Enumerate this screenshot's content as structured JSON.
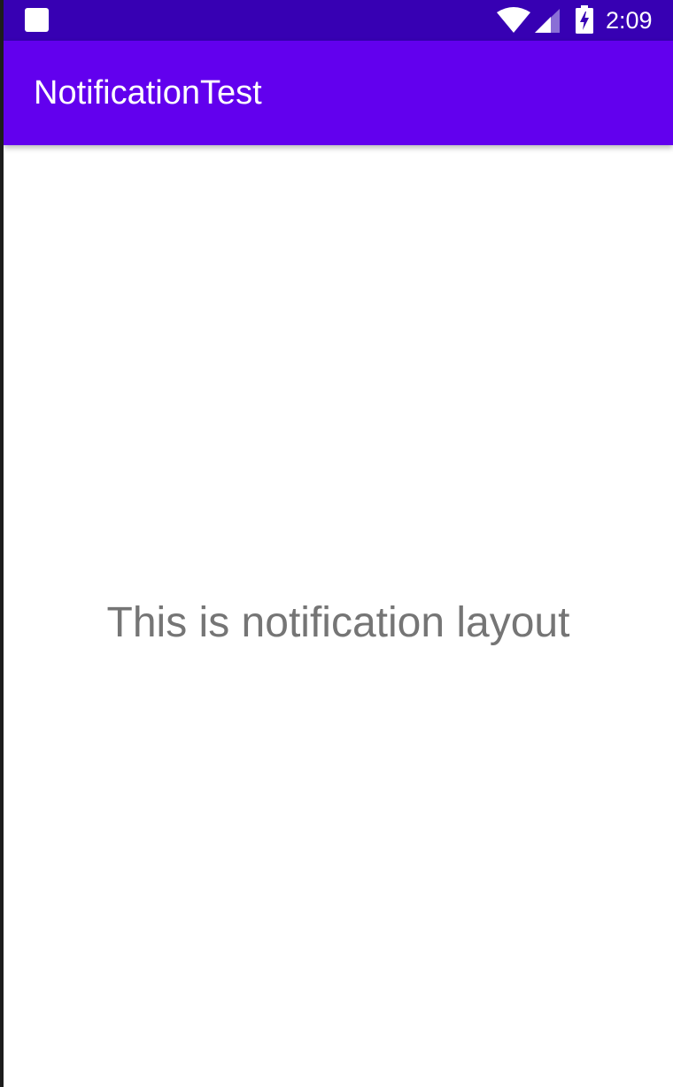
{
  "status_bar": {
    "time": "2:09",
    "icons": [
      "notification-square-icon",
      "wifi-icon",
      "cell-signal-icon",
      "battery-charging-icon"
    ]
  },
  "app_bar": {
    "title": "NotificationTest"
  },
  "content": {
    "message": "This is notification layout"
  },
  "colors": {
    "status_bar": "#3700b3",
    "app_bar": "#6200ee",
    "background": "#ffffff",
    "message_text": "#757575"
  }
}
